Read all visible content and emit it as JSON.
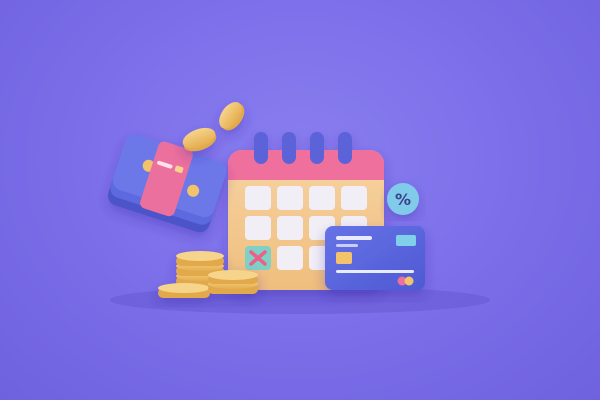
{
  "scene": {
    "background_color": "#7b6de8",
    "objects": [
      {
        "name": "wallet-with-card-icon"
      },
      {
        "name": "floating-coin-icon"
      },
      {
        "name": "coin-stack-icon"
      },
      {
        "name": "calendar-icon"
      },
      {
        "name": "calendar-cross-mark-icon"
      },
      {
        "name": "percent-badge-icon",
        "text": "%"
      },
      {
        "name": "credit-card-icon"
      }
    ]
  },
  "colors": {
    "calendar_body": "#f5c98e",
    "calendar_header": "#ef6f9d",
    "calendar_rings": "#5b63d8",
    "card_body": "#5a66dc",
    "coin": "#f2c36b",
    "wallet_blue": "#5d69df",
    "wallet_pink": "#ec6f9d",
    "percent_badge": "#7fcbe9"
  }
}
